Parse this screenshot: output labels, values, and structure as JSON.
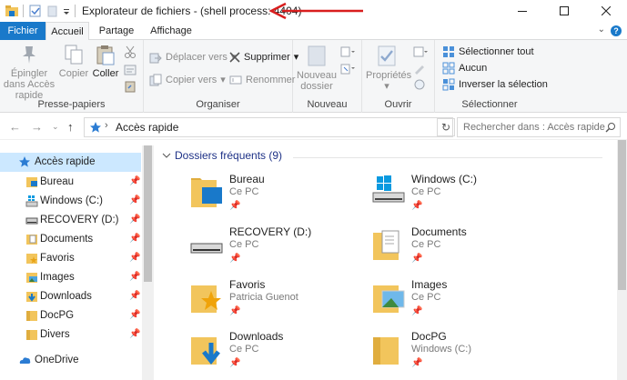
{
  "window": {
    "title": "Explorateur de fichiers - (shell process: 4404)"
  },
  "ribbon_tabs": [
    {
      "label": "Fichier"
    },
    {
      "label": "Accueil"
    },
    {
      "label": "Partage"
    },
    {
      "label": "Affichage"
    }
  ],
  "ribbon": {
    "clipboard": {
      "pin": "Épingler dans Accès rapide",
      "copy": "Copier",
      "paste": "Coller",
      "label": "Presse-papiers"
    },
    "organize": {
      "move": "Déplacer vers",
      "copy_to": "Copier vers",
      "delete": "Supprimer",
      "rename": "Renommer",
      "label": "Organiser"
    },
    "new": {
      "folder": "Nouveau dossier",
      "label": "Nouveau"
    },
    "open": {
      "properties": "Propriétés",
      "label": "Ouvrir"
    },
    "select": {
      "select_all": "Sélectionner tout",
      "none": "Aucun",
      "invert": "Inverser la sélection",
      "label": "Sélectionner"
    }
  },
  "address": {
    "location": "Accès rapide",
    "search_placeholder": "Rechercher dans : Accès rapide"
  },
  "navpane": {
    "items": [
      {
        "label": "Accès rapide",
        "icon": "star-icon"
      },
      {
        "label": "Bureau",
        "icon": "desktop-icon"
      },
      {
        "label": "Windows (C:)",
        "icon": "drive-c-icon"
      },
      {
        "label": "RECOVERY (D:)",
        "icon": "drive-d-icon"
      },
      {
        "label": "Documents",
        "icon": "documents-icon"
      },
      {
        "label": "Favoris",
        "icon": "favorites-icon"
      },
      {
        "label": "Images",
        "icon": "images-icon"
      },
      {
        "label": "Downloads",
        "icon": "downloads-icon"
      },
      {
        "label": "DocPG",
        "icon": "folder-icon"
      },
      {
        "label": "Divers",
        "icon": "folder-icon"
      },
      {
        "label": "OneDrive",
        "icon": "onedrive-icon"
      }
    ]
  },
  "content": {
    "section_title": "Dossiers fréquents (9)",
    "folders": [
      {
        "name": "Bureau",
        "location": "Ce PC"
      },
      {
        "name": "Windows (C:)",
        "location": "Ce PC"
      },
      {
        "name": "RECOVERY (D:)",
        "location": "Ce PC"
      },
      {
        "name": "Documents",
        "location": "Ce PC"
      },
      {
        "name": "Favoris",
        "location": "Patricia Guenot"
      },
      {
        "name": "Images",
        "location": "Ce PC"
      },
      {
        "name": "Downloads",
        "location": "Ce PC"
      },
      {
        "name": "DocPG",
        "location": "Windows (C:)"
      }
    ]
  },
  "colors": {
    "accent": "#1979ca",
    "selection": "#cce8ff",
    "folder": "#f2c55c",
    "annotation_arrow": "#d91e1e"
  }
}
